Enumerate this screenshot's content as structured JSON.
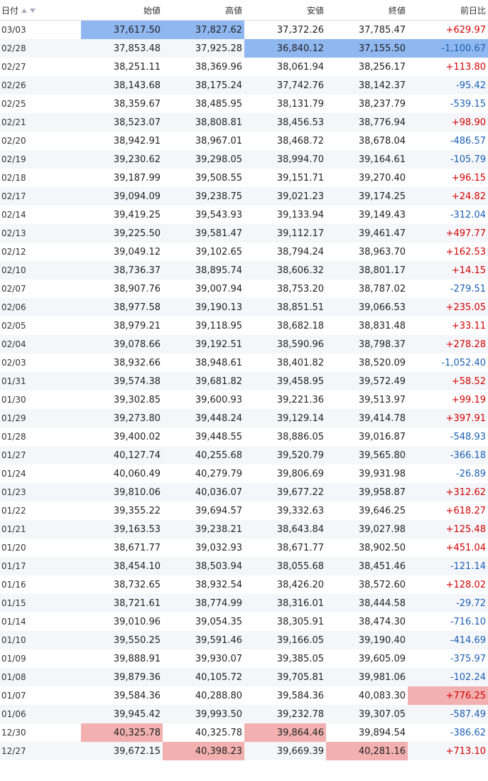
{
  "header": {
    "date": "日付",
    "open": "始値",
    "high": "高値",
    "low": "安値",
    "close": "終値",
    "change": "前日比"
  },
  "colors": {
    "positive": "#d40000",
    "negative": "#1a5fb4",
    "highlight_blue": "#8fb8f0",
    "highlight_red": "#f2b0b0"
  },
  "rows": [
    {
      "date": "03/03",
      "open": "37,617.50",
      "high": "37,827.62",
      "low": "37,372.26",
      "close": "37,785.47",
      "change": "+629.97",
      "hl": {
        "open": "blue",
        "high": "blue"
      }
    },
    {
      "date": "02/28",
      "open": "37,853.48",
      "high": "37,925.28",
      "low": "36,840.12",
      "close": "37,155.50",
      "change": "-1,100.67",
      "hl": {
        "low": "blue",
        "close": "blue",
        "change": "blue"
      }
    },
    {
      "date": "02/27",
      "open": "38,251.11",
      "high": "38,369.96",
      "low": "38,061.94",
      "close": "38,256.17",
      "change": "+113.80"
    },
    {
      "date": "02/26",
      "open": "38,143.68",
      "high": "38,175.24",
      "low": "37,742.76",
      "close": "38,142.37",
      "change": "-95.42"
    },
    {
      "date": "02/25",
      "open": "38,359.67",
      "high": "38,485.95",
      "low": "38,131.79",
      "close": "38,237.79",
      "change": "-539.15"
    },
    {
      "date": "02/21",
      "open": "38,523.07",
      "high": "38,808.81",
      "low": "38,456.53",
      "close": "38,776.94",
      "change": "+98.90"
    },
    {
      "date": "02/20",
      "open": "38,942.91",
      "high": "38,967.01",
      "low": "38,468.72",
      "close": "38,678.04",
      "change": "-486.57"
    },
    {
      "date": "02/19",
      "open": "39,230.62",
      "high": "39,298.05",
      "low": "38,994.70",
      "close": "39,164.61",
      "change": "-105.79"
    },
    {
      "date": "02/18",
      "open": "39,187.99",
      "high": "39,508.55",
      "low": "39,151.71",
      "close": "39,270.40",
      "change": "+96.15"
    },
    {
      "date": "02/17",
      "open": "39,094.09",
      "high": "39,238.75",
      "low": "39,021.23",
      "close": "39,174.25",
      "change": "+24.82"
    },
    {
      "date": "02/14",
      "open": "39,419.25",
      "high": "39,543.93",
      "low": "39,133.94",
      "close": "39,149.43",
      "change": "-312.04"
    },
    {
      "date": "02/13",
      "open": "39,225.50",
      "high": "39,581.47",
      "low": "39,112.17",
      "close": "39,461.47",
      "change": "+497.77"
    },
    {
      "date": "02/12",
      "open": "39,049.12",
      "high": "39,102.65",
      "low": "38,794.24",
      "close": "38,963.70",
      "change": "+162.53"
    },
    {
      "date": "02/10",
      "open": "38,736.37",
      "high": "38,895.74",
      "low": "38,606.32",
      "close": "38,801.17",
      "change": "+14.15"
    },
    {
      "date": "02/07",
      "open": "38,907.76",
      "high": "39,007.94",
      "low": "38,753.20",
      "close": "38,787.02",
      "change": "-279.51"
    },
    {
      "date": "02/06",
      "open": "38,977.58",
      "high": "39,190.13",
      "low": "38,851.51",
      "close": "39,066.53",
      "change": "+235.05"
    },
    {
      "date": "02/05",
      "open": "38,979.21",
      "high": "39,118.95",
      "low": "38,682.18",
      "close": "38,831.48",
      "change": "+33.11"
    },
    {
      "date": "02/04",
      "open": "39,078.66",
      "high": "39,192.51",
      "low": "38,590.96",
      "close": "38,798.37",
      "change": "+278.28"
    },
    {
      "date": "02/03",
      "open": "38,932.66",
      "high": "38,948.61",
      "low": "38,401.82",
      "close": "38,520.09",
      "change": "-1,052.40"
    },
    {
      "date": "01/31",
      "open": "39,574.38",
      "high": "39,681.82",
      "low": "39,458.95",
      "close": "39,572.49",
      "change": "+58.52"
    },
    {
      "date": "01/30",
      "open": "39,302.85",
      "high": "39,600.93",
      "low": "39,221.36",
      "close": "39,513.97",
      "change": "+99.19"
    },
    {
      "date": "01/29",
      "open": "39,273.80",
      "high": "39,448.24",
      "low": "39,129.14",
      "close": "39,414.78",
      "change": "+397.91"
    },
    {
      "date": "01/28",
      "open": "39,400.02",
      "high": "39,448.55",
      "low": "38,886.05",
      "close": "39,016.87",
      "change": "-548.93"
    },
    {
      "date": "01/27",
      "open": "40,127.74",
      "high": "40,255.68",
      "low": "39,520.79",
      "close": "39,565.80",
      "change": "-366.18"
    },
    {
      "date": "01/24",
      "open": "40,060.49",
      "high": "40,279.79",
      "low": "39,806.69",
      "close": "39,931.98",
      "change": "-26.89"
    },
    {
      "date": "01/23",
      "open": "39,810.06",
      "high": "40,036.07",
      "low": "39,677.22",
      "close": "39,958.87",
      "change": "+312.62"
    },
    {
      "date": "01/22",
      "open": "39,355.22",
      "high": "39,694.57",
      "low": "39,332.63",
      "close": "39,646.25",
      "change": "+618.27"
    },
    {
      "date": "01/21",
      "open": "39,163.53",
      "high": "39,238.21",
      "low": "38,643.84",
      "close": "39,027.98",
      "change": "+125.48"
    },
    {
      "date": "01/20",
      "open": "38,671.77",
      "high": "39,032.93",
      "low": "38,671.77",
      "close": "38,902.50",
      "change": "+451.04"
    },
    {
      "date": "01/17",
      "open": "38,454.10",
      "high": "38,503.94",
      "low": "38,055.68",
      "close": "38,451.46",
      "change": "-121.14"
    },
    {
      "date": "01/16",
      "open": "38,732.65",
      "high": "38,932.54",
      "low": "38,426.20",
      "close": "38,572.60",
      "change": "+128.02"
    },
    {
      "date": "01/15",
      "open": "38,721.61",
      "high": "38,774.99",
      "low": "38,316.01",
      "close": "38,444.58",
      "change": "-29.72"
    },
    {
      "date": "01/14",
      "open": "39,010.96",
      "high": "39,054.35",
      "low": "38,305.91",
      "close": "38,474.30",
      "change": "-716.10"
    },
    {
      "date": "01/10",
      "open": "39,550.25",
      "high": "39,591.46",
      "low": "39,166.05",
      "close": "39,190.40",
      "change": "-414.69"
    },
    {
      "date": "01/09",
      "open": "39,888.91",
      "high": "39,930.07",
      "low": "39,385.05",
      "close": "39,605.09",
      "change": "-375.97"
    },
    {
      "date": "01/08",
      "open": "39,879.36",
      "high": "40,105.72",
      "low": "39,705.81",
      "close": "39,981.06",
      "change": "-102.24"
    },
    {
      "date": "01/07",
      "open": "39,584.36",
      "high": "40,288.80",
      "low": "39,584.36",
      "close": "40,083.30",
      "change": "+776.25",
      "hl": {
        "change": "red"
      }
    },
    {
      "date": "01/06",
      "open": "39,945.42",
      "high": "39,993.50",
      "low": "39,232.78",
      "close": "39,307.05",
      "change": "-587.49"
    },
    {
      "date": "12/30",
      "open": "40,325.78",
      "high": "40,325.78",
      "low": "39,864.46",
      "close": "39,894.54",
      "change": "-386.62",
      "hl": {
        "open": "red",
        "low": "red"
      }
    },
    {
      "date": "12/27",
      "open": "39,672.15",
      "high": "40,398.23",
      "low": "39,669.39",
      "close": "40,281.16",
      "change": "+713.10",
      "hl": {
        "high": "red",
        "close": "red"
      }
    }
  ]
}
